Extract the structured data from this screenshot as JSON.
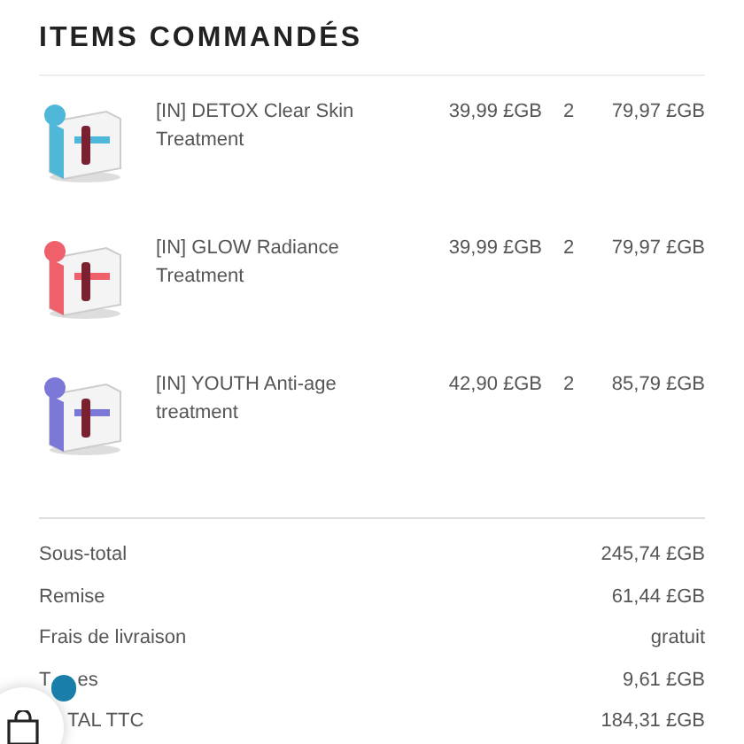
{
  "heading": "ITEMS COMMANDÉS",
  "items": [
    {
      "name": "[IN] DETOX Clear Skin Treatment",
      "price": "39,99 £GB",
      "quantity": "2",
      "total": "79,97 £GB",
      "color": "#4fb8d8"
    },
    {
      "name": "[IN] GLOW Radiance Treatment",
      "price": "39,99 £GB",
      "quantity": "2",
      "total": "79,97 £GB",
      "color": "#f0606a"
    },
    {
      "name": "[IN] YOUTH Anti-age treatment",
      "price": "42,90 £GB",
      "quantity": "2",
      "total": "85,79 £GB",
      "color": "#7c78d8"
    }
  ],
  "summary": [
    {
      "label": [
        "Sous-total"
      ],
      "value": "245,74 £GB",
      "covered_start": false
    },
    {
      "label": [
        "Remise"
      ],
      "value": "61,44 £GB",
      "covered_start": false
    },
    {
      "label": [
        "Frais de livraison"
      ],
      "value": "gratuit",
      "covered_start": false
    },
    {
      "label": [
        "T",
        "es"
      ],
      "value": "9,61 £GB",
      "covered_start": false
    },
    {
      "label": [
        "TAL TTC"
      ],
      "value": "184,31 £GB",
      "covered_start": true
    }
  ]
}
